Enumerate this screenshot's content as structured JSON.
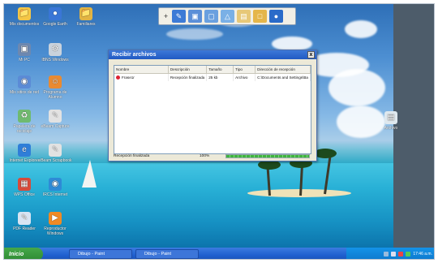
{
  "desktop_icons": [
    {
      "label": "Mis documentos",
      "color": "#f4c646"
    },
    {
      "label": "Google Earth",
      "color": "#3a76d6"
    },
    {
      "label": "Familiares",
      "color": "#e2b443"
    },
    {
      "label": "Mi PC",
      "color": "#6d88b0"
    },
    {
      "label": "IBNS Windows",
      "color": "#c9d2dc"
    },
    {
      "label": "Mis sitios de red",
      "color": "#5b8bd6"
    },
    {
      "label": "Programa de Alumno",
      "color": "#e98a32"
    },
    {
      "label": "Papelera de reciclaje",
      "color": "#6fba6f"
    },
    {
      "label": "eBeam Capture",
      "color": "#e2e2e2"
    },
    {
      "label": "Internet Explorer",
      "color": "#2f7ed8"
    },
    {
      "label": "eBeam Scrapbook",
      "color": "#e2e2e2"
    },
    {
      "label": "WPS Office",
      "color": "#d84a3a"
    },
    {
      "label": "IRCS Internet",
      "color": "#2e8ad6"
    },
    {
      "label": "PDF Reader",
      "color": "#d8e4f2"
    },
    {
      "label": "Reproductor Windows",
      "color": "#f08a24"
    },
    {
      "label": "Archivo",
      "color": "#dfe8ee"
    }
  ],
  "toolbar": {
    "buttons": [
      "plus-icon",
      "pen-icon",
      "eraser-icon",
      "screen-icon",
      "picture-icon",
      "document-icon",
      "folder-icon",
      "globe-icon"
    ]
  },
  "dialog": {
    "title": "Recibir archivos",
    "close_label": "x",
    "columns": [
      "Nombre",
      "Descripción",
      "Tamaño",
      "Tipo",
      "Dirección de recepción"
    ],
    "rows": [
      [
        "Frase1r",
        "Recepción finalizada",
        "25 kb",
        "Archivo",
        "C:\\Documents and Settings\\Ba"
      ]
    ],
    "status_label": "Recepción finalizada",
    "status_value": "100%",
    "progress_percent": 100
  },
  "taskbar": {
    "start_label": "Inicio",
    "tasks": [
      "Dibujo - Paint",
      "Dibujo - Paint"
    ],
    "clock": "17:46 a.m."
  }
}
